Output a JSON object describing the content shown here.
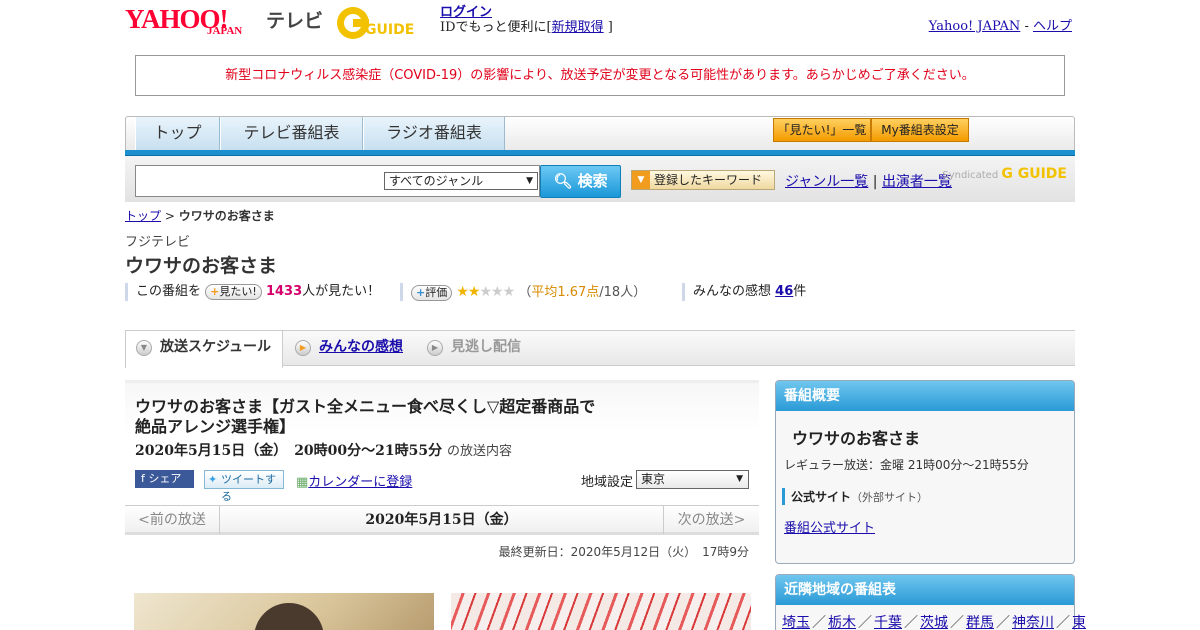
{
  "header": {
    "logo_yahoo": "YAHOO!",
    "logo_japan": "JAPAN",
    "logo_tv": "テレビ",
    "logo_g": "G GUIDE",
    "login_label": "ログイン",
    "login_sub": "IDでもっと便利に[",
    "signup_label": "新規取得",
    "login_sub_end": "]",
    "yahoo_japan_link": "Yahoo! JAPAN",
    "help_sep": "-",
    "help_link": "ヘルプ"
  },
  "notice": "新型コロナウィルス感染症（COVID-19）の影響により、放送予定が変更となる可能性があります。あらかじめご了承ください。",
  "nav": {
    "tabs": [
      "トップ",
      "テレビ番組表",
      "ラジオ番組表"
    ],
    "want_list": "「見たい!」一覧",
    "my_schedule": "My番組表設定"
  },
  "search": {
    "input_value": "",
    "genre": "すべてのジャンル",
    "button": "検索",
    "keyword_button": "登録したキーワード",
    "genre_list": "ジャンル一覧",
    "sep": "|",
    "performer_list": "出演者一覧",
    "syndicated": "Syndicated",
    "syndicated_logo": "G GUIDE"
  },
  "breadcrumb": {
    "top": "トップ",
    "sep": ">",
    "current": "ウワサのお客さま"
  },
  "program": {
    "station": "フジテレビ",
    "title": "ウワサのお客さま",
    "want_prefix": "この番組を",
    "want_pill": "見たい!",
    "want_count": "1433",
    "want_suffix": "人が見たい！",
    "rate_pill": "評価",
    "rating": 1.67,
    "avg_open": "（",
    "avg_label": "平均1.67点",
    "avg_people": "/18人）",
    "impressions_label": "みんなの感想",
    "impressions_count": "46",
    "impressions_suffix": "件"
  },
  "tabs": {
    "schedule": "放送スケジュール",
    "impressions": "みんなの感想",
    "missed": "見逃し配信"
  },
  "episode": {
    "title": "ウワサのお客さま【ガスト全メニュー食べ尽くし▽超定番商品で絶品アレンジ選手権】",
    "date": "2020年5月15日（金）　20時00分～21時55分",
    "date_suffix": "の放送内容",
    "share_fb": "シェア",
    "share_tw": "ツイートする",
    "calendar": "カレンダーに登録",
    "region_label": "地域設定",
    "region_value": "東京",
    "prev": "<前の放送",
    "current_date": "2020年5月15日（金）",
    "next": "次の放送>",
    "updated": "最終更新日：2020年5月12日（火）　17時9分"
  },
  "overview": {
    "head": "番組概要",
    "title": "ウワサのお客さま",
    "regular": "レギュラー放送：金曜 21時00分～21時55分",
    "official_label": "公式サイト",
    "official_note": "（外部サイト）",
    "official_link": "番組公式サイト"
  },
  "nearby": {
    "head": "近隣地域の番組表",
    "regions": [
      "埼玉",
      "栃木",
      "千葉",
      "茨城",
      "群馬",
      "神奈川",
      "東"
    ]
  }
}
